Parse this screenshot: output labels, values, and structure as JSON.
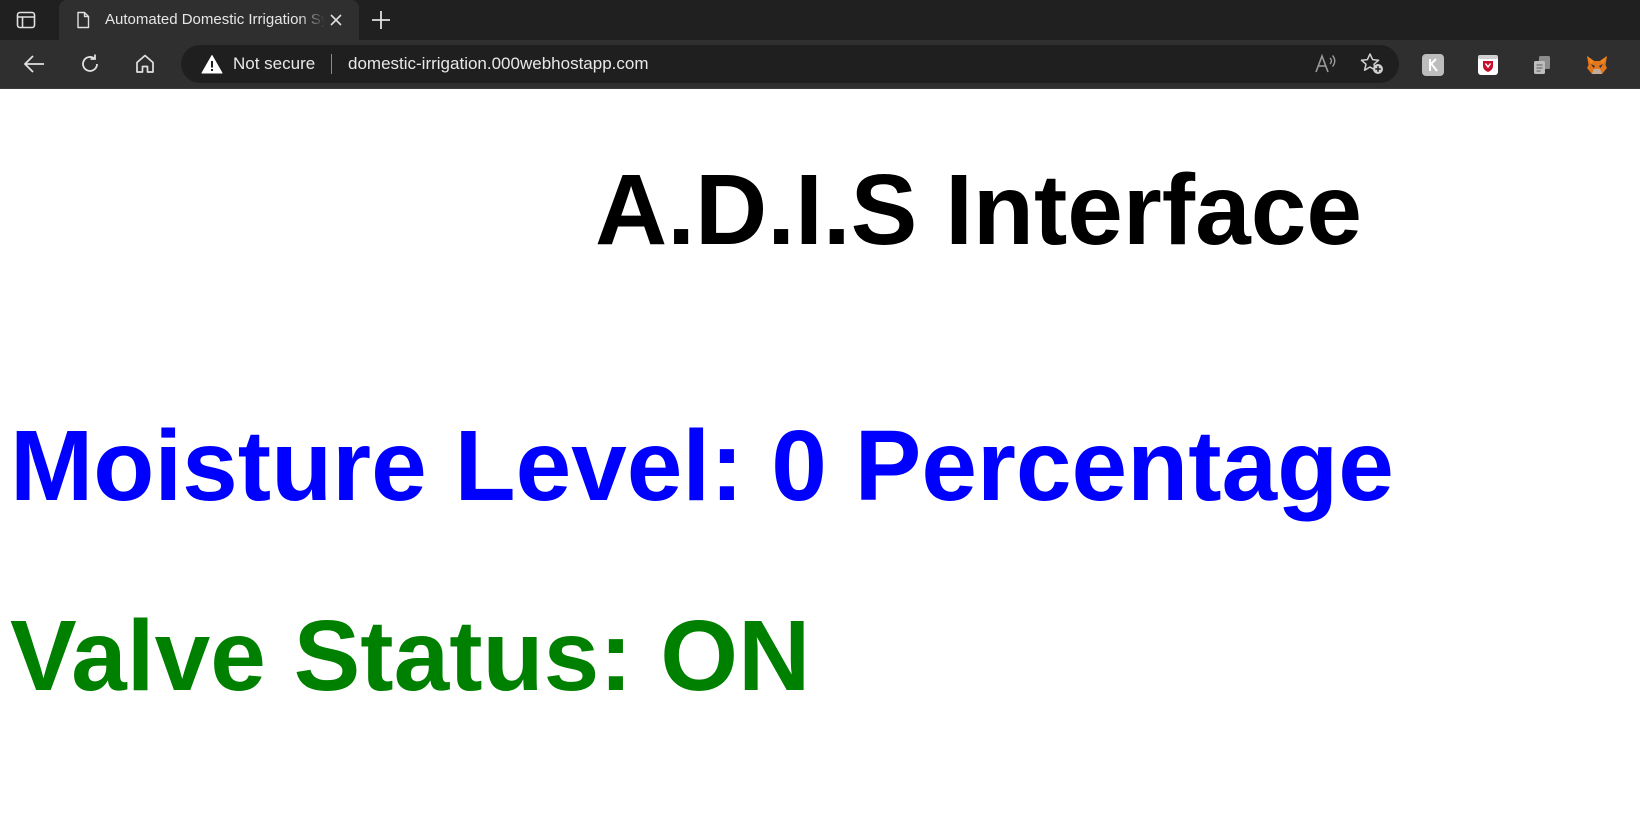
{
  "browser": {
    "tab": {
      "title": "Automated Domestic Irrigation System"
    },
    "address_bar": {
      "security_label": "Not secure",
      "url": "domestic-irrigation.000webhostapp.com"
    },
    "icons": {
      "tab_actions": "tab-actions-icon",
      "page": "page-icon",
      "close": "close-icon",
      "new_tab": "plus-icon",
      "back": "back-arrow-icon",
      "reload": "reload-icon",
      "home": "home-icon",
      "warning": "warning-icon",
      "read_aloud": "read-aloud-icon",
      "add_favorite": "star-plus-icon"
    },
    "extensions": [
      "extension-grey-icon",
      "extension-red-shield-icon",
      "extension-copy-icon",
      "extension-fox-icon"
    ]
  },
  "page": {
    "title": "A.D.I.S Interface",
    "moisture_text": "Moisture Level: 0 Percentage",
    "valve_text": "Valve Status: ON"
  },
  "colors": {
    "title": "#000000",
    "moisture": "#0000ff",
    "valve": "#008000",
    "chrome_dark": "#202020",
    "chrome_toolbar": "#2f2f2f"
  }
}
